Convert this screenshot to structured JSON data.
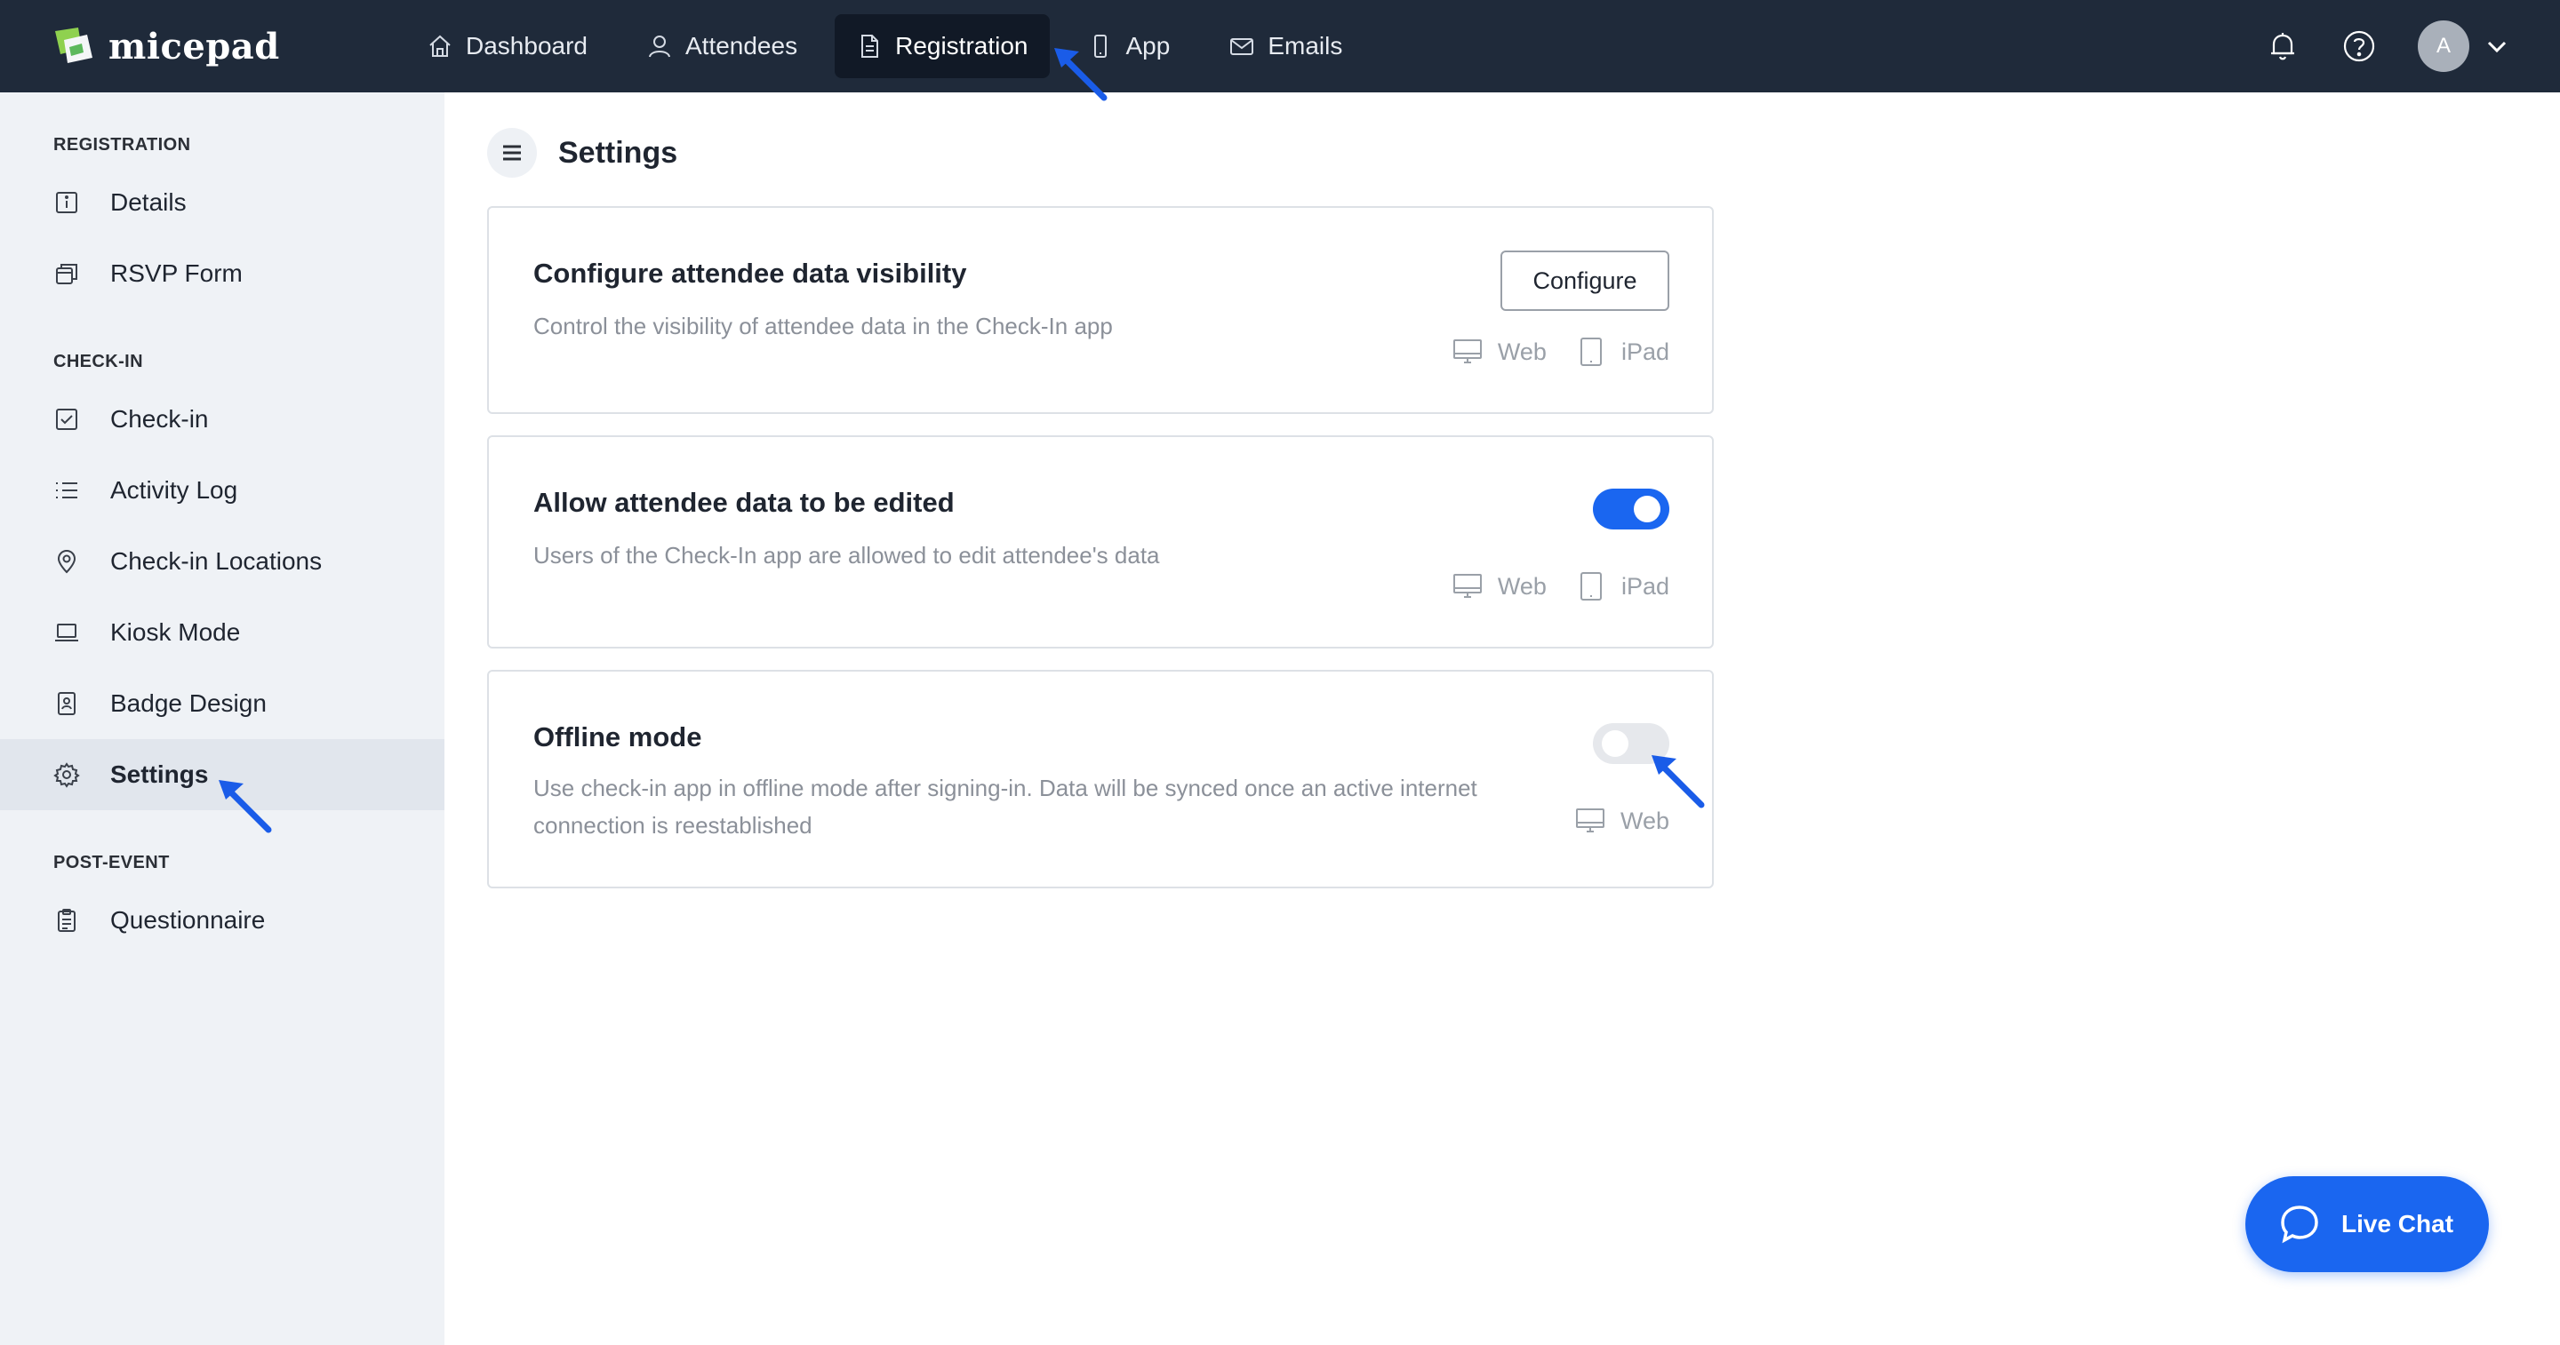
{
  "app": {
    "name": "micepad"
  },
  "nav": {
    "items": [
      {
        "label": "Dashboard",
        "icon": "home-icon"
      },
      {
        "label": "Attendees",
        "icon": "user-icon"
      },
      {
        "label": "Registration",
        "icon": "document-icon",
        "active": true
      },
      {
        "label": "App",
        "icon": "phone-icon"
      },
      {
        "label": "Emails",
        "icon": "mail-icon"
      }
    ],
    "avatar_initial": "A"
  },
  "sidebar": {
    "sections": [
      {
        "title": "REGISTRATION",
        "items": [
          {
            "label": "Details",
            "icon": "info-icon"
          },
          {
            "label": "RSVP Form",
            "icon": "form-icon"
          }
        ]
      },
      {
        "title": "CHECK-IN",
        "items": [
          {
            "label": "Check-in",
            "icon": "checkbox-icon"
          },
          {
            "label": "Activity Log",
            "icon": "list-icon"
          },
          {
            "label": "Check-in Locations",
            "icon": "location-pin-icon"
          },
          {
            "label": "Kiosk Mode",
            "icon": "laptop-icon"
          },
          {
            "label": "Badge Design",
            "icon": "badge-icon"
          },
          {
            "label": "Settings",
            "icon": "gear-icon",
            "active": true
          }
        ]
      },
      {
        "title": "POST-EVENT",
        "items": [
          {
            "label": "Questionnaire",
            "icon": "clipboard-icon"
          }
        ]
      }
    ]
  },
  "page": {
    "title": "Settings",
    "cards": [
      {
        "title": "Configure attendee data visibility",
        "description": "Control the visibility of attendee data in the Check-In app",
        "button_label": "Configure",
        "platforms": [
          "Web",
          "iPad"
        ]
      },
      {
        "title": "Allow attendee data to be edited",
        "description": "Users of the Check-In app are allowed to edit attendee's data",
        "toggle_on": true,
        "platforms": [
          "Web",
          "iPad"
        ]
      },
      {
        "title": "Offline mode",
        "description_line1": "Use check-in app in offline mode after signing-in. Data will be synced once an active internet",
        "description_line2": "connection is reestablished",
        "toggle_on": false,
        "platforms": [
          "Web"
        ]
      }
    ]
  },
  "livechat": {
    "label": "Live Chat"
  },
  "colors": {
    "topbar": "#1f2a3a",
    "accent": "#1a66f0",
    "sidebar": "#eff2f6"
  }
}
